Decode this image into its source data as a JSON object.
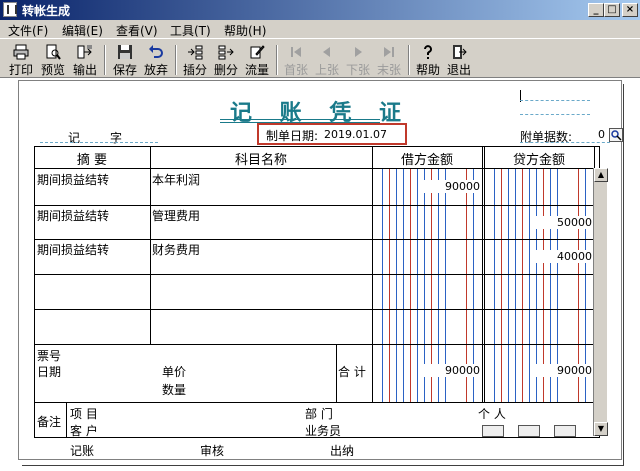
{
  "window": {
    "title": "转帐生成"
  },
  "menu": [
    {
      "label": "文件(F)"
    },
    {
      "label": "编辑(E)"
    },
    {
      "label": "查看(V)"
    },
    {
      "label": "工具(T)"
    },
    {
      "label": "帮助(H)"
    }
  ],
  "toolbar": [
    {
      "label": "打印",
      "icon": "printer-icon",
      "enabled": true
    },
    {
      "label": "预览",
      "icon": "preview-icon",
      "enabled": true
    },
    {
      "label": "输出",
      "icon": "export-icon",
      "enabled": true
    },
    {
      "label": "保存",
      "icon": "save-icon",
      "enabled": true
    },
    {
      "label": "放弃",
      "icon": "undo-icon",
      "enabled": true
    },
    {
      "label": "插分",
      "icon": "insert-row-icon",
      "enabled": true
    },
    {
      "label": "删分",
      "icon": "delete-row-icon",
      "enabled": true
    },
    {
      "label": "流量",
      "icon": "edit-pen-icon",
      "enabled": true
    },
    {
      "label": "首张",
      "icon": "first-icon",
      "enabled": false
    },
    {
      "label": "上张",
      "icon": "prev-icon",
      "enabled": false
    },
    {
      "label": "下张",
      "icon": "next-icon",
      "enabled": false
    },
    {
      "label": "末张",
      "icon": "last-icon",
      "enabled": false
    },
    {
      "label": "帮助",
      "icon": "help-icon",
      "enabled": true
    },
    {
      "label": "退出",
      "icon": "exit-icon",
      "enabled": true
    }
  ],
  "voucher": {
    "title": "记 账 凭 证",
    "type_label": "记",
    "number_label": "字",
    "date_label": "制单日期:",
    "date_value": "2019.01.07",
    "attach_label": "附单据数:",
    "attach_value": "0"
  },
  "table": {
    "headers": {
      "summary": "摘 要",
      "account": "科目名称",
      "debit": "借方金额",
      "credit": "贷方金额"
    },
    "rows": [
      {
        "summary": "期间损益结转",
        "account": "本年利润",
        "debit": "90000",
        "credit": ""
      },
      {
        "summary": "期间损益结转",
        "account": "管理费用",
        "debit": "",
        "credit": "50000"
      },
      {
        "summary": "期间损益结转",
        "account": "财务费用",
        "debit": "",
        "credit": "40000"
      },
      {
        "summary": "",
        "account": "",
        "debit": "",
        "credit": ""
      },
      {
        "summary": "",
        "account": "",
        "debit": "",
        "credit": ""
      }
    ],
    "footer": {
      "bill_no_label": "票号",
      "date_label": "日期",
      "unit_price_label": "单价",
      "quantity_label": "数量",
      "total_label": "合 计",
      "total_debit": "90000",
      "total_credit": "90000"
    },
    "remarks": {
      "label": "备注",
      "project_label": "项 目",
      "customer_label": "客 户",
      "department_label": "部 门",
      "salesperson_label": "业务员",
      "person_label": "个 人"
    }
  },
  "signatures": {
    "bookkeeper": "记账",
    "reviewer": "审核",
    "cashier": "出纳"
  },
  "colors": {
    "title": "#1a7a8a",
    "highlight": "#c0392b",
    "titlebar": "#0a246a"
  }
}
